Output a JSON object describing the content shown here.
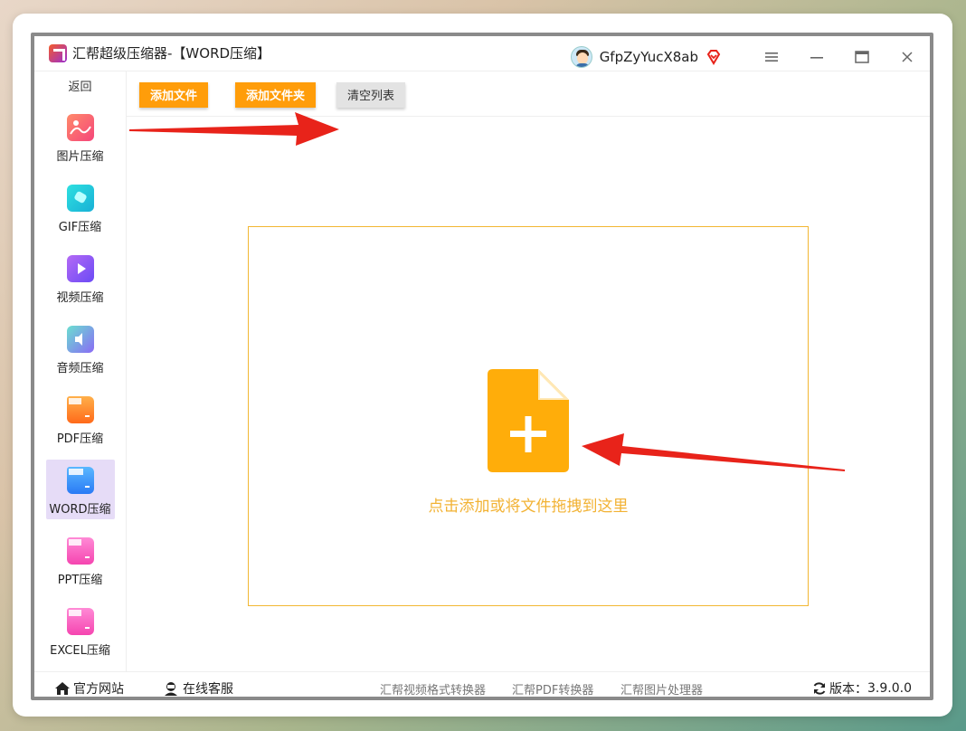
{
  "window": {
    "app_name": "汇帮超级压缩器",
    "title_suffix": " -【WORD压缩】",
    "username": "GfpZyYucX8ab"
  },
  "controls": {
    "menu_icon": "menu-icon",
    "minimize_icon": "minimize-icon",
    "maximize_icon": "maximize-icon",
    "close_icon": "close-icon"
  },
  "sidebar": {
    "back_label": "返回",
    "items": [
      {
        "label": "图片压缩",
        "icon": "image-icon",
        "color": "#f56a7a"
      },
      {
        "label": "GIF压缩",
        "icon": "gif-icon",
        "color": "#18c8d6"
      },
      {
        "label": "视频压缩",
        "icon": "video-icon",
        "color": "#8a5cf5"
      },
      {
        "label": "音频压缩",
        "icon": "audio-icon",
        "color": "#4fc6e0"
      },
      {
        "label": "PDF压缩",
        "icon": "pdf-icon",
        "color": "#ff8a2a"
      },
      {
        "label": "WORD压缩",
        "icon": "word-icon",
        "color": "#3a9af5",
        "active": true
      },
      {
        "label": "PPT压缩",
        "icon": "ppt-icon",
        "color": "#f560c0"
      },
      {
        "label": "EXCEL压缩",
        "icon": "excel-icon",
        "color": "#f560c0"
      }
    ]
  },
  "toolbar": {
    "add_file_label": "添加文件",
    "add_folder_label": "添加文件夹",
    "clear_list_label": "清空列表"
  },
  "dropzone": {
    "text": "点击添加或将文件拖拽到这里"
  },
  "footer": {
    "website_label": "官方网站",
    "support_label": "在线客服",
    "links": [
      "汇帮视频格式转换器",
      "汇帮PDF转换器",
      "汇帮图片处理器"
    ],
    "version_label": "版本：",
    "version_value": "3.9.0.0"
  },
  "colors": {
    "accent_orange": "#ff9d0a",
    "active_nav_bg": "#e6dcf7",
    "dropzone_border": "#f2b733",
    "annotation_arrow": "#e8231a"
  }
}
